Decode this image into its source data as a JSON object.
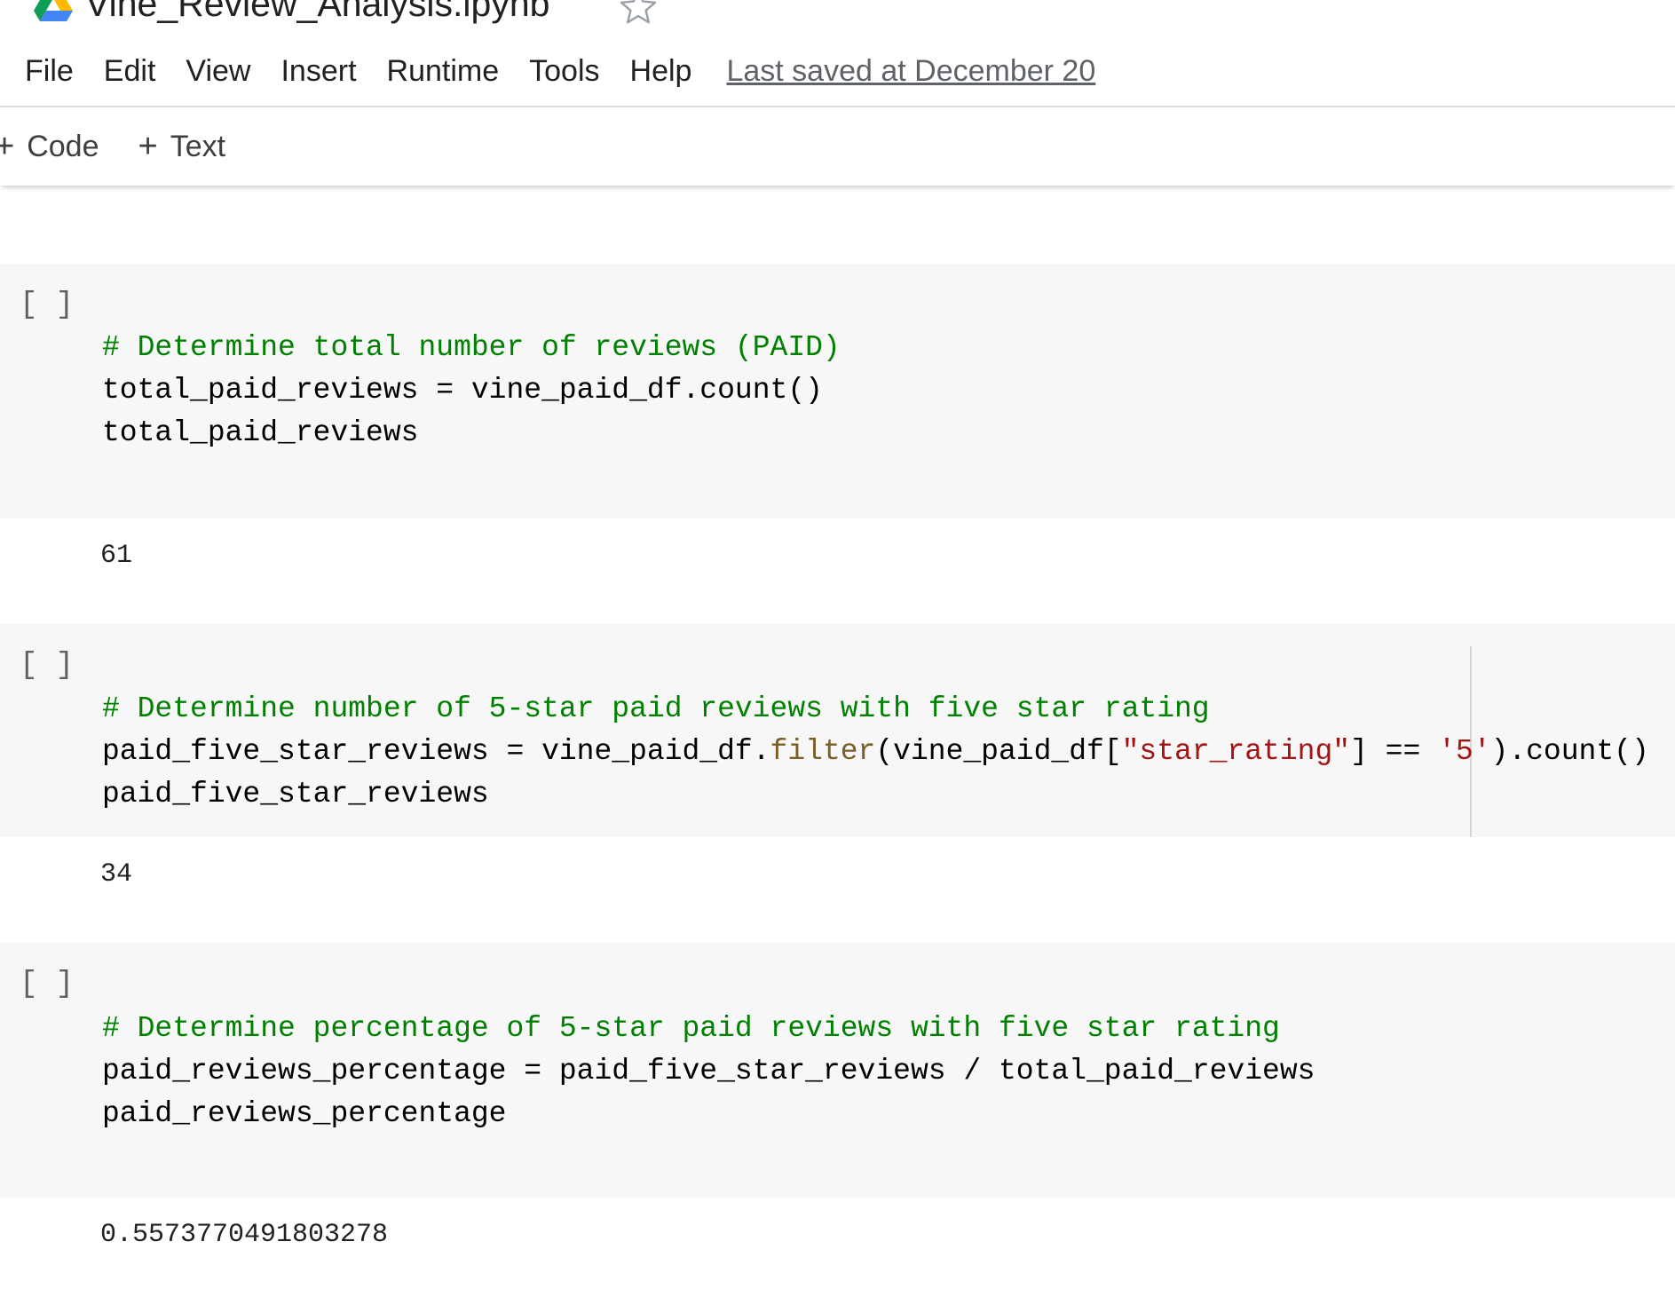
{
  "header": {
    "title": "Vine_Review_Analysis.ipynb",
    "logo_icon": "google-drive-icon",
    "star_icon": "star-outline-icon",
    "menu": [
      "File",
      "Edit",
      "View",
      "Insert",
      "Runtime",
      "Tools",
      "Help"
    ],
    "last_saved": "Last saved at December 20"
  },
  "toolbar": {
    "code_label": "Code",
    "text_label": "Text",
    "plus_symbol": "+"
  },
  "cells": [
    {
      "run_indicator": "[ ]",
      "comment": "# Determine total number of reviews (PAID)",
      "line2": "total_paid_reviews = vine_paid_df.count()",
      "line3": "total_paid_reviews",
      "output": "61"
    },
    {
      "run_indicator": "[ ]",
      "comment": "# Determine number of 5-star paid reviews with five star rating",
      "line2_a": "paid_five_star_reviews = vine_paid_df.",
      "line2_func": "filter",
      "line2_b": "(vine_paid_df[",
      "line2_str1": "\"star_rating\"",
      "line2_c": "] == ",
      "line2_str2": "'5'",
      "line2_d": ").count()",
      "line3": "paid_five_star_reviews",
      "output": "34"
    },
    {
      "run_indicator": "[ ]",
      "comment": "# Determine percentage of 5-star paid reviews with five star rating",
      "line2": "paid_reviews_percentage = paid_five_star_reviews / total_paid_reviews",
      "line3": "paid_reviews_percentage",
      "output": "0.5573770491803278"
    }
  ],
  "colors": {
    "comment": "#008000",
    "function": "#795e26",
    "string": "#a31515",
    "cell_background": "#f7f7f7"
  }
}
